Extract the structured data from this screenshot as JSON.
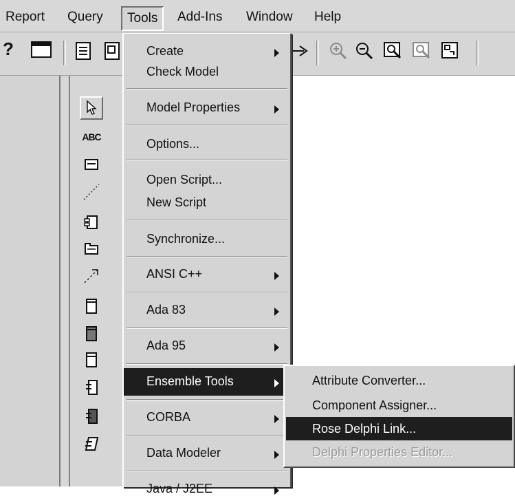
{
  "menubar": {
    "items": [
      {
        "label": "Report"
      },
      {
        "label": "Query"
      },
      {
        "label": "Tools"
      },
      {
        "label": "Add-Ins"
      },
      {
        "label": "Window"
      },
      {
        "label": "Help"
      }
    ]
  },
  "toolbar": {
    "buttons": [
      {
        "icon": "context-help-icon",
        "text": "?"
      },
      {
        "icon": "window-icon"
      },
      {
        "icon": "document-icon"
      },
      {
        "icon": "properties-icon"
      },
      {
        "icon": "arrow-icon"
      },
      {
        "icon": "zoom-in-icon"
      },
      {
        "icon": "zoom-out-icon"
      },
      {
        "icon": "fit-in-window-icon"
      },
      {
        "icon": "undo-fit-icon"
      },
      {
        "icon": "browse-icon"
      }
    ]
  },
  "palette": {
    "tools": [
      {
        "icon": "selection-pointer-icon"
      },
      {
        "icon": "text-box-icon",
        "text": "ABC"
      },
      {
        "icon": "note-icon"
      },
      {
        "icon": "anchor-note-icon"
      },
      {
        "icon": "component-icon"
      },
      {
        "icon": "package-icon"
      },
      {
        "icon": "dependency-icon"
      },
      {
        "icon": "subprogram-spec-icon"
      },
      {
        "icon": "subprogram-body-icon"
      },
      {
        "icon": "main-program-icon"
      },
      {
        "icon": "package-spec-icon"
      },
      {
        "icon": "package-body-icon"
      },
      {
        "icon": "task-spec-icon"
      }
    ]
  },
  "tools_menu": {
    "items": [
      {
        "label": "Create",
        "submenu": true
      },
      {
        "label": "Check Model",
        "submenu": false
      },
      {
        "label": "Model Properties",
        "submenu": true
      },
      {
        "label": "Options...",
        "submenu": false
      },
      {
        "label": "Open Script...",
        "submenu": false
      },
      {
        "label": "New Script",
        "submenu": false
      },
      {
        "label": "Synchronize...",
        "submenu": false
      },
      {
        "label": "ANSI C++",
        "submenu": true
      },
      {
        "label": "Ada 83",
        "submenu": true
      },
      {
        "label": "Ada 95",
        "submenu": true
      },
      {
        "label": "Ensemble Tools",
        "submenu": true,
        "highlighted": true
      },
      {
        "label": "CORBA",
        "submenu": true
      },
      {
        "label": "Data Modeler",
        "submenu": true
      },
      {
        "label": "Java / J2EE",
        "submenu": true
      }
    ]
  },
  "ensemble_submenu": {
    "items": [
      {
        "label": "Attribute Converter..."
      },
      {
        "label": "Component Assigner..."
      },
      {
        "label": "Rose Delphi Link...",
        "highlighted": true
      },
      {
        "label": "Delphi Properties Editor...",
        "disabled": true
      }
    ]
  },
  "colors": {
    "menu_bg": "#d4d4d4",
    "highlight_bg": "#1e1e1e",
    "highlight_text": "#ffffff",
    "disabled_text": "#9a9a9a"
  }
}
